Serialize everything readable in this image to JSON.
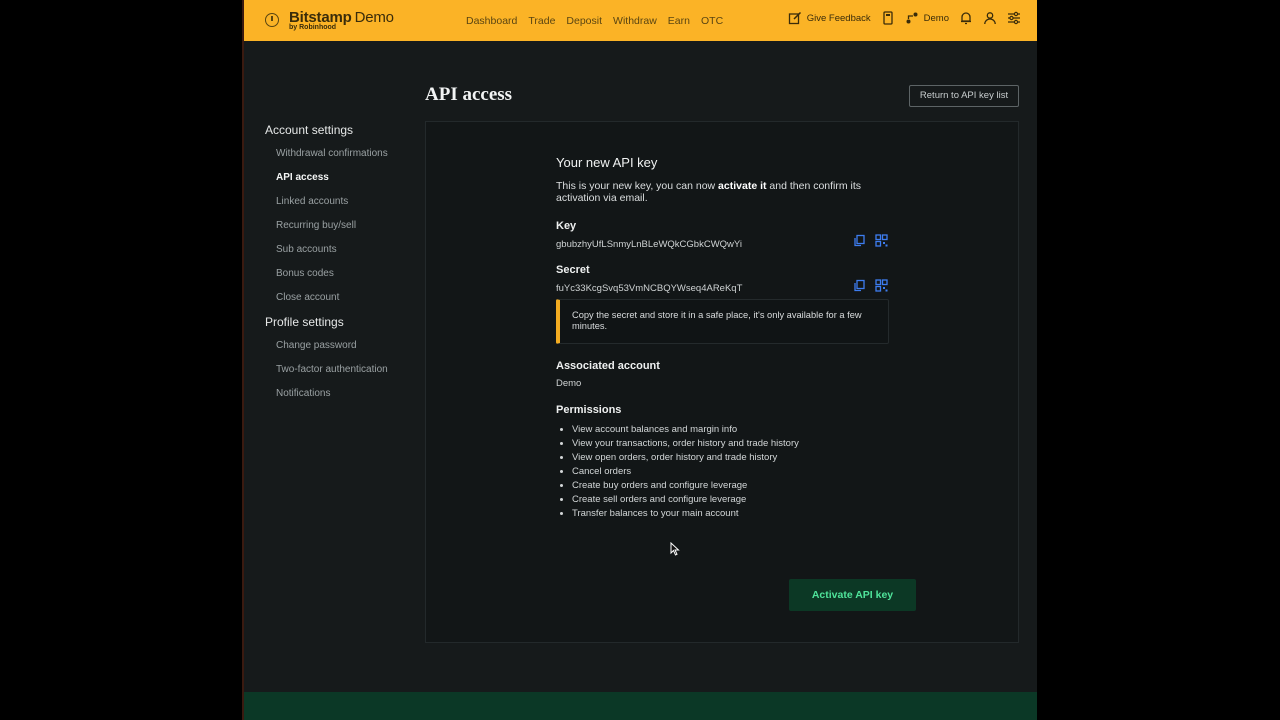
{
  "header": {
    "brand": "Bitstamp",
    "brand_suffix": "Demo",
    "brand_sub": "by Robinhood",
    "nav": [
      "Dashboard",
      "Trade",
      "Deposit",
      "Withdraw",
      "Earn",
      "OTC"
    ],
    "feedback_label": "Give Feedback",
    "account_label": "Demo",
    "accent_color": "#fbb326"
  },
  "sidebar": {
    "account_settings": "Account settings",
    "account_items": [
      "Withdrawal confirmations",
      "API access",
      "Linked accounts",
      "Recurring buy/sell",
      "Sub accounts",
      "Bonus codes",
      "Close account"
    ],
    "active_item": "API access",
    "profile_settings": "Profile settings",
    "profile_items": [
      "Change password",
      "Two-factor authentication",
      "Notifications"
    ]
  },
  "main": {
    "title": "API access",
    "return_label": "Return to API key list",
    "new_key_title": "Your new API key",
    "intro_pre": "This is your new key, you can now ",
    "intro_bold": "activate it",
    "intro_post": " and then confirm its activation via email.",
    "key_label": "Key",
    "key_value": "gbubzhyUfLSnmyLnBLeWQkCGbkCWQwYi",
    "secret_label": "Secret",
    "secret_value": "fuYc33KcgSvq53VmNCBQYWseq4AReKqT",
    "warning": "Copy the secret and store it in a safe place, it's only available for a few minutes.",
    "warning_color": "#f3ac21",
    "assoc_label": "Associated account",
    "assoc_value": "Demo",
    "permissions_label": "Permissions",
    "permissions": [
      "View account balances and margin info",
      "View your transactions, order history and trade history",
      "View open orders, order history and trade history",
      "Cancel orders",
      "Create buy orders and configure leverage",
      "Create sell orders and configure leverage",
      "Transfer balances to your main account"
    ],
    "activate_label": "Activate API key",
    "activate_color": "#4fe39a"
  }
}
